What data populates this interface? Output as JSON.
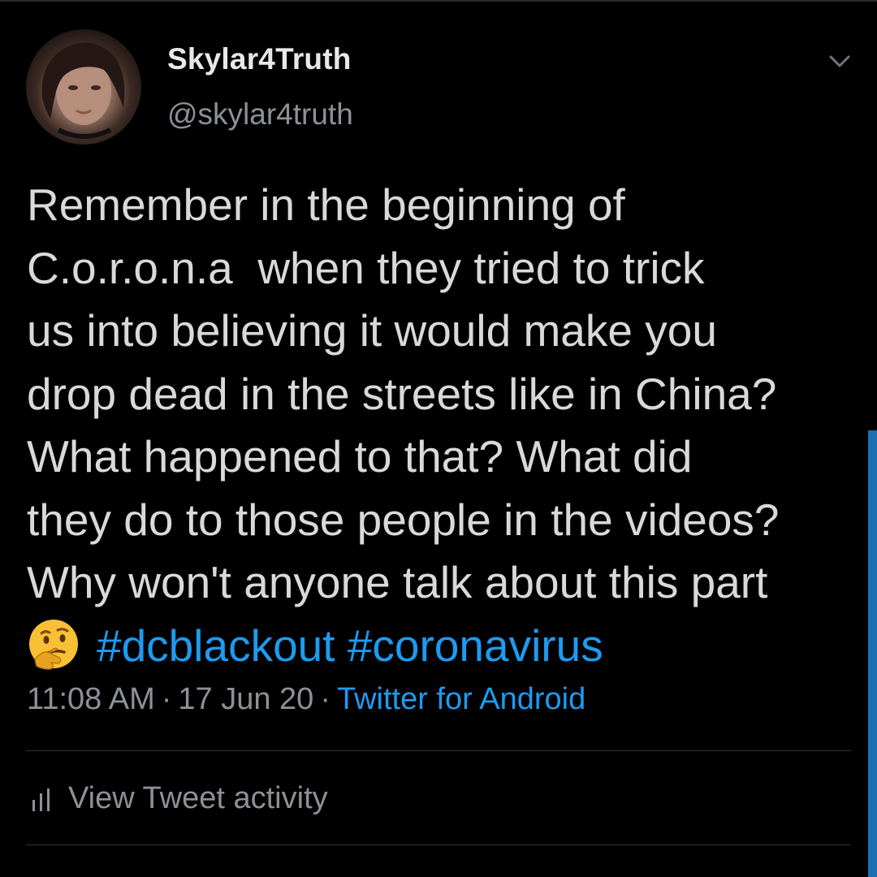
{
  "header": {
    "display_name": "Skylar4Truth",
    "handle": "@skylar4truth"
  },
  "tweet": {
    "lines": [
      "Remember in the beginning of",
      "C.o.r.o.n.a  when they tried to trick",
      "us into believing it would make you",
      "drop dead in the streets like in China?",
      "What happened to that? What did",
      "they do to those people in the videos?",
      "Why won't anyone talk about this part"
    ],
    "emoji": "thinking-face",
    "hashtags": [
      "#dcblackout",
      "#coronavirus"
    ]
  },
  "meta": {
    "time": "11:08 AM",
    "date": "17 Jun 20",
    "source": "Twitter for Android"
  },
  "activity": {
    "label": "View Tweet activity"
  },
  "icons": {
    "caret": "chevron-down-icon",
    "activity": "bar-chart-icon",
    "emoji": "thinking-face-emoji"
  },
  "colors": {
    "background": "#000000",
    "text": "#d9d9d9",
    "secondary": "#8c9196",
    "accent": "#1d9bf0"
  }
}
